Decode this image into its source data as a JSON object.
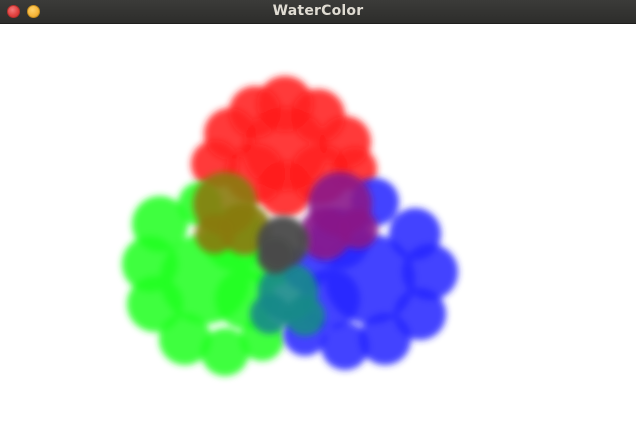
{
  "window": {
    "title": "WaterColor"
  },
  "canvas": {
    "background": "#ffffff",
    "blobs": [
      {
        "name": "red-blob",
        "color": "#ff2020",
        "opacity": 0.88
      },
      {
        "name": "green-blob",
        "color": "#22ff22",
        "opacity": 0.88
      },
      {
        "name": "blue-blob",
        "color": "#2828ff",
        "opacity": 0.88
      }
    ],
    "overlap_colors": {
      "red_green": "#8a7a12",
      "red_blue": "#8a1a8a",
      "green_blue": "#1a8a8a",
      "center": "#4a4a4a"
    }
  }
}
